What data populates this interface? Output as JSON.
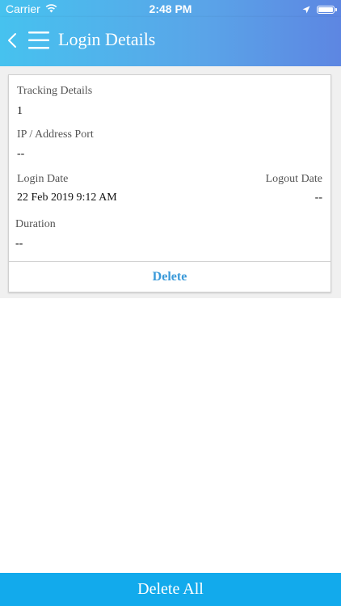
{
  "status_bar": {
    "carrier": "Carrier",
    "time": "2:48 PM"
  },
  "nav": {
    "title": "Login Details",
    "back_icon": "chevron-left-icon",
    "menu_icon": "hamburger-menu-icon"
  },
  "card": {
    "tracking_label": "Tracking Details",
    "tracking_value": "1",
    "ip_label": "IP / Address Port",
    "ip_value": "--",
    "login_date_label": "Login Date",
    "login_date_value": "22 Feb 2019 9:12 AM",
    "logout_date_label": "Logout Date",
    "logout_date_value": "--",
    "duration_label": "Duration",
    "duration_value": "--",
    "delete_label": "Delete"
  },
  "footer": {
    "delete_all_label": "Delete All"
  },
  "colors": {
    "header_start": "#46c2ef",
    "header_end": "#5d86e2",
    "delete_text": "#3b9ad9",
    "delete_all_bg": "#12aaec"
  }
}
